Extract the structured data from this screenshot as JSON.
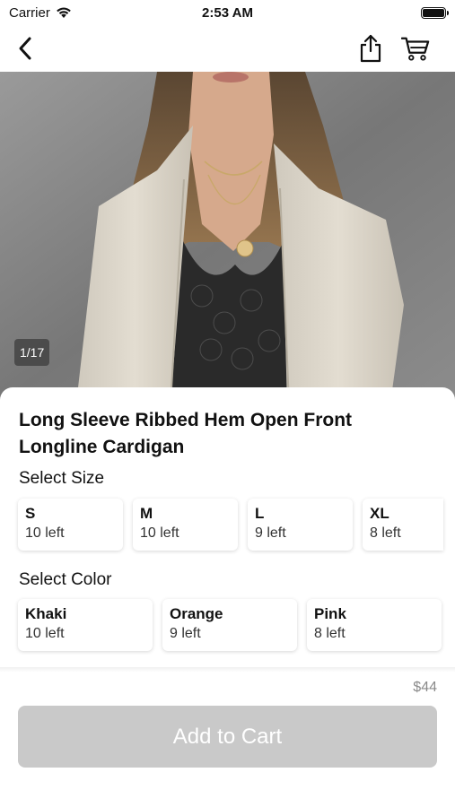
{
  "status_bar": {
    "carrier": "Carrier",
    "time": "2:53 AM"
  },
  "nav": {
    "back_icon": "chevron-left-icon",
    "share_icon": "share-icon",
    "cart_icon": "cart-icon"
  },
  "gallery": {
    "counter": "1/17"
  },
  "product": {
    "title": "Long Sleeve Ribbed Hem Open Front Longline Cardigan"
  },
  "size": {
    "label": "Select Size",
    "options": [
      {
        "name": "S",
        "stock": "10 left"
      },
      {
        "name": "M",
        "stock": "10 left"
      },
      {
        "name": "L",
        "stock": "9 left"
      },
      {
        "name": "XL",
        "stock": "8 left"
      }
    ]
  },
  "color": {
    "label": "Select Color",
    "options": [
      {
        "name": "Khaki",
        "stock": "10 left"
      },
      {
        "name": "Orange",
        "stock": "9 left"
      },
      {
        "name": "Pink",
        "stock": "8 left"
      }
    ]
  },
  "footer": {
    "price": "$44",
    "add_to_cart": "Add to Cart"
  },
  "colors": {
    "button_disabled": "#c9c9c9",
    "price_text": "#8a8a8a"
  }
}
